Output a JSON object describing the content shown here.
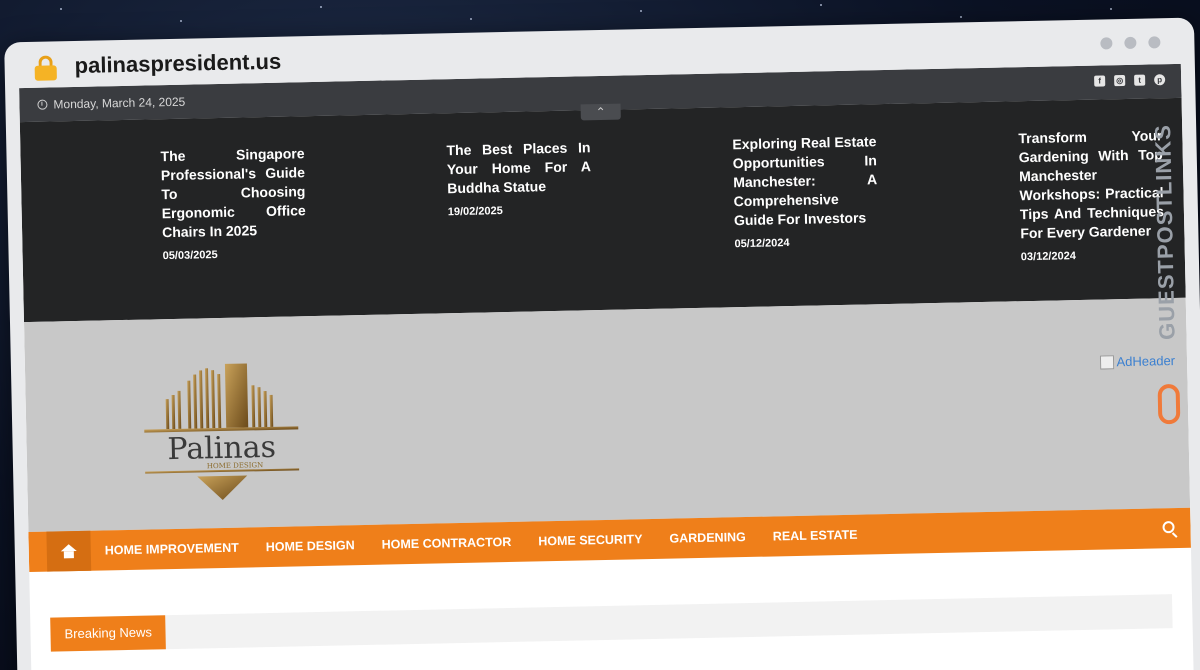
{
  "browser": {
    "url": "palinaspresident.us"
  },
  "topbar": {
    "date": "Monday, March 24, 2025",
    "social_icons": [
      "facebook-icon",
      "instagram-icon",
      "twitter-icon",
      "pinterest-icon"
    ]
  },
  "featured_posts": [
    {
      "title": "The Singapore Professional's Guide To Choosing Ergonomic Office Chairs In 2025",
      "date": "05/03/2025"
    },
    {
      "title": "The Best Places In Your Home For A Buddha Statue",
      "date": "19/02/2025"
    },
    {
      "title": "Exploring Real Estate Opportunities In Manchester: A Comprehensive Guide For Investors",
      "date": "05/12/2024"
    },
    {
      "title": "Transform Your Gardening With Top Manchester Workshops: Practical Tips And Techniques For Every Gardener",
      "date": "03/12/2024"
    }
  ],
  "header": {
    "logo_name": "Palinas",
    "logo_tagline": "HOME DESIGN",
    "ad_alt": "AdHeader"
  },
  "nav": {
    "items": [
      "HOME IMPROVEMENT",
      "HOME DESIGN",
      "HOME CONTRACTOR",
      "HOME SECURITY",
      "GARDENING",
      "REAL ESTATE"
    ]
  },
  "breaking": {
    "label": "Breaking News"
  },
  "watermark": {
    "text": "GUESTPOSTLINKS"
  },
  "colors": {
    "accent": "#ef7f1a",
    "topbar": "#3a3c40",
    "featured_bg": "#232425",
    "header_bg": "#c8c8c8"
  }
}
